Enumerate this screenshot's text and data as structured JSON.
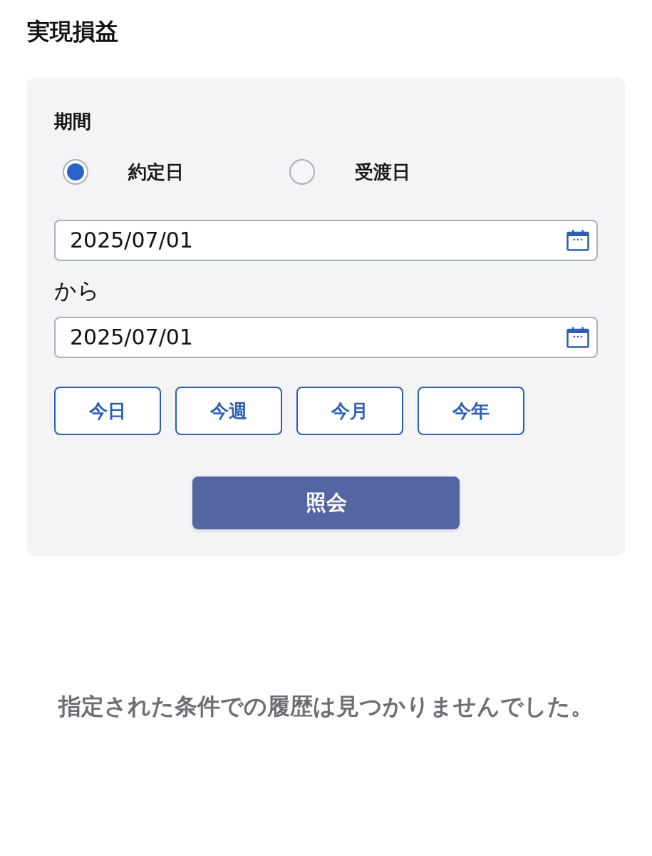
{
  "page": {
    "title": "実現損益"
  },
  "filter": {
    "period_label": "期間",
    "date_basis": [
      {
        "label": "約定日",
        "selected": true
      },
      {
        "label": "受渡日",
        "selected": false
      }
    ],
    "date_from": {
      "value": "2025/07/01"
    },
    "range_separator": "から",
    "date_to": {
      "value": "2025/07/01"
    },
    "quick_ranges": [
      "今日",
      "今週",
      "今月",
      "今年"
    ],
    "submit_button": "照会"
  },
  "empty_message": "指定された条件での履歴は見つかりませんでした。"
}
